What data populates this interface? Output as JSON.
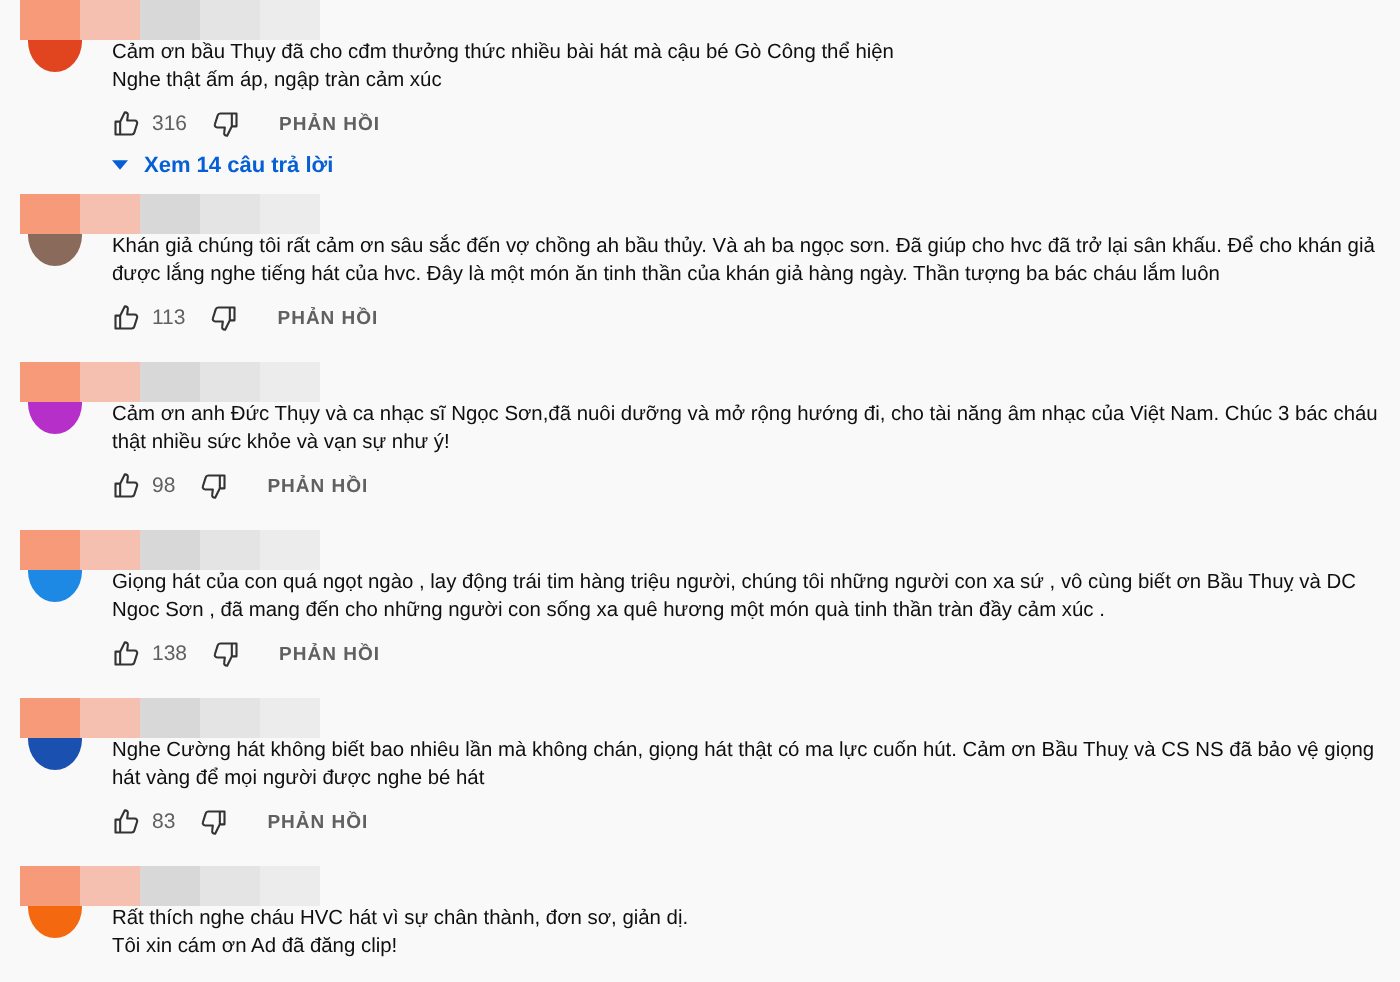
{
  "comments": [
    {
      "color": "#e0451f",
      "lines": [
        "Cảm ơn bầu Thụy đã cho cđm thưởng thức nhiều bài hát mà cậu bé Gò Công thể hiện",
        "Nghe thật ấm áp, ngập tràn cảm xúc"
      ],
      "likes": "316",
      "reply": "PHẢN HỒI",
      "replies": "Xem 14 câu trả lời"
    },
    {
      "color": "#8a6a5a",
      "lines": [
        "Khán giả chúng tôi rất cảm ơn sâu sắc đến vợ chồng ah bầu thủy. Và ah ba ngọc sơn. Đã giúp cho hvc đã trở lại sân khấu.  Để cho khán giả",
        "được lắng nghe tiếng hát của hvc.  Đây là một món ăn tinh thần của khán giả hàng ngày.    Thần tượng ba bác cháu lắm luôn"
      ],
      "likes": "113",
      "reply": "PHẢN HỒI"
    },
    {
      "color": "#b62fc9",
      "lines": [
        "Cảm ơn anh Đức Thụy và ca nhạc sĩ Ngọc Sơn,đã nuôi dưỡng và mở rộng hướng đi, cho tài năng âm nhạc của Việt Nam. Chúc 3 bác cháu",
        "thật nhiều sức khỏe và vạn sự như ý!"
      ],
      "likes": "98",
      "reply": "PHẢN HỒI"
    },
    {
      "color": "#1e88e5",
      "lines": [
        "Giọng hát  của con quá ngọt ngào , lay động trái tim hàng triệu người,  chúng tôi những người con xa sứ , vô cùng biết ơn Bầu Thuỵ và  DC",
        "Ngoc Sơn , đã mang đến cho những người con sống xa quê hương một món quà tinh thần tràn đầy cảm xúc ."
      ],
      "likes": "138",
      "reply": "PHẢN HỒI"
    },
    {
      "color": "#1a50b0",
      "lines": [
        "Nghe Cường hát không biết bao nhiêu lần mà không chán, giọng hát thật có ma lực cuốn hút. Cảm ơn Bầu Thuỵ và CS NS đã bảo vệ giọng",
        "hát vàng để mọi người được nghe bé hát"
      ],
      "likes": "83",
      "reply": "PHẢN HỒI"
    },
    {
      "color": "#f4690f",
      "lines": [
        "Rất thích nghe cháu HVC hát vì sự chân thành, đơn sơ, giản dị.",
        "Tôi xin cám ơn Ad đã đăng clip!"
      ]
    }
  ]
}
